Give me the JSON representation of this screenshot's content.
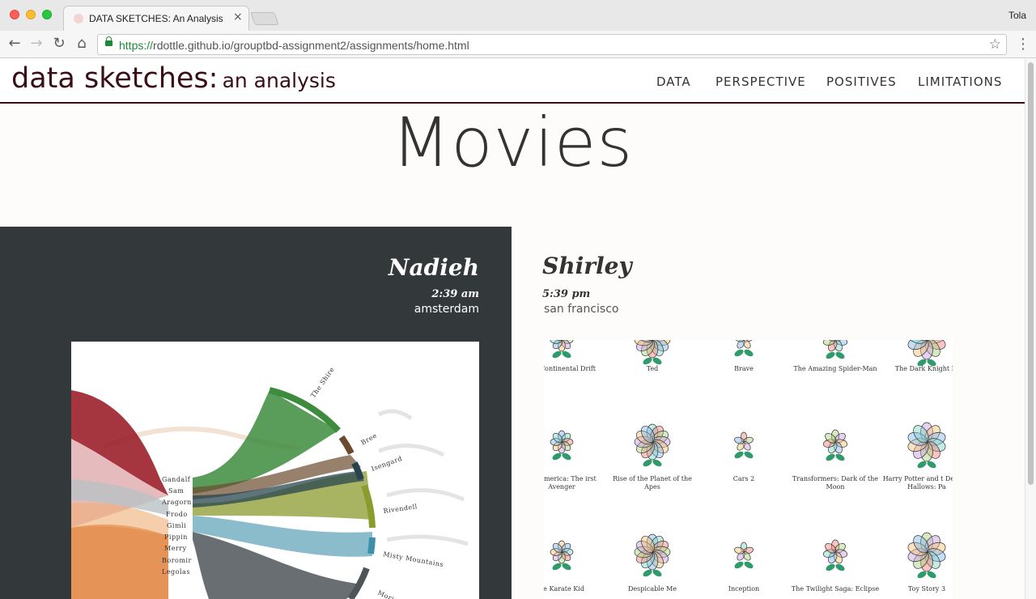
{
  "browser": {
    "tab_title": "DATA SKETCHES: An Analysis",
    "tab_close": "×",
    "user": "Tola",
    "url_protocol": "https://",
    "url_rest": "rdottle.github.io/grouptbd-assignment2/assignments/home.html",
    "icons": {
      "back": "back-arrow-icon",
      "forward": "forward-arrow-icon",
      "reload": "reload-icon",
      "home": "home-icon",
      "secure": "lock-icon",
      "bookmark": "star-icon",
      "menu": "menu-dots-icon"
    }
  },
  "site": {
    "brand_main": "data sketches:",
    "brand_sub": "an analysis",
    "nav": [
      "DATA",
      "PERSPECTIVE",
      "POSITIVES",
      "LIMITATIONS"
    ],
    "accent_color": "#3a0e16"
  },
  "page": {
    "title": "Movies"
  },
  "nadieh": {
    "name": "Nadieh",
    "time": "2:39 am",
    "city": "amsterdam",
    "chart_characters": [
      "Gandalf",
      "Sam",
      "Aragorn",
      "Frodo",
      "Gimli",
      "Pippin",
      "Merry",
      "Boromir",
      "Legolas"
    ],
    "chart_locations": [
      "The Shire",
      "Bree",
      "Isengard",
      "Rivendell",
      "Misty Mountains",
      "Moria"
    ]
  },
  "shirley": {
    "name": "Shirley",
    "time": "5:39 pm",
    "city": "san francisco",
    "movies": [
      [
        "ge: Continental Drift",
        "Ted",
        "Brave",
        "The Amazing Spider-Man",
        "The Dark Knight Ri"
      ],
      [
        "ain America: The irst Avenger",
        "Rise of the Planet of the Apes",
        "Cars 2",
        "Transformers: Dark of the Moon",
        "Harry Potter and t Deathly Hallows: Pa"
      ],
      [
        "he Karate Kid",
        "Despicable Me",
        "Inception",
        "The Twilight Saga: Eclipse",
        "Toy Story 3"
      ]
    ]
  }
}
